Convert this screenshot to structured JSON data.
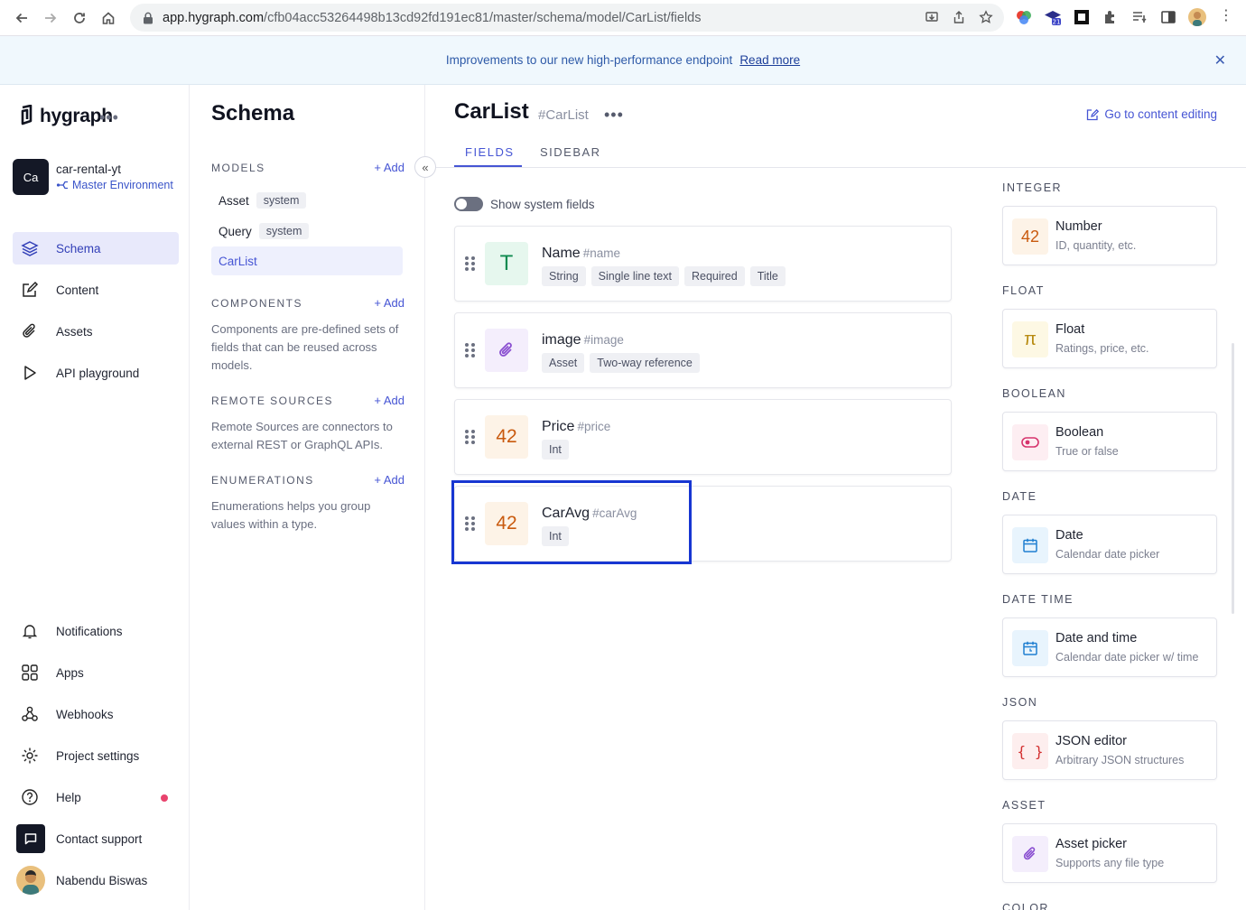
{
  "browser": {
    "url_host": "app.hygraph.com",
    "url_path": "/cfb04acc53264498b13cd92fd191ec81/master/schema/model/CarList/fields",
    "ext_badge": "21"
  },
  "banner": {
    "text": "Improvements to our new high-performance endpoint",
    "link": "Read more"
  },
  "sidebar": {
    "logo": "hygraph",
    "project_initials": "Ca",
    "project_name": "car-rental-yt",
    "environment": "Master Environment",
    "nav": [
      {
        "label": "Schema"
      },
      {
        "label": "Content"
      },
      {
        "label": "Assets"
      },
      {
        "label": "API playground"
      }
    ],
    "bottom": [
      {
        "label": "Notifications"
      },
      {
        "label": "Apps"
      },
      {
        "label": "Webhooks"
      },
      {
        "label": "Project settings"
      },
      {
        "label": "Help"
      },
      {
        "label": "Contact support"
      },
      {
        "label": "Nabendu Biswas"
      }
    ]
  },
  "schema": {
    "title": "Schema",
    "add_label": "Add",
    "models_head": "MODELS",
    "models": [
      {
        "name": "Asset",
        "tag": "system"
      },
      {
        "name": "Query",
        "tag": "system"
      },
      {
        "name": "CarList"
      }
    ],
    "components_head": "COMPONENTS",
    "components_desc": "Components are pre-defined sets of fields that can be reused across models.",
    "remote_head": "REMOTE SOURCES",
    "remote_desc": "Remote Sources are connectors to external REST or GraphQL APIs.",
    "enum_head": "ENUMERATIONS",
    "enum_desc": "Enumerations helps you group values within a type."
  },
  "main": {
    "title": "CarList",
    "api_id": "#CarList",
    "goto": "Go to content editing",
    "tabs": [
      "FIELDS",
      "SIDEBAR"
    ],
    "toggle_label": "Show system fields",
    "fields": [
      {
        "icon": "T",
        "name": "Name",
        "api": "#name",
        "tags": [
          "String",
          "Single line text",
          "Required",
          "Title"
        ]
      },
      {
        "icon": "",
        "name": "image",
        "api": "#image",
        "tags": [
          "Asset",
          "Two-way reference"
        ]
      },
      {
        "icon": "42",
        "name": "Price",
        "api": "#price",
        "tags": [
          "Int"
        ]
      },
      {
        "icon": "42",
        "name": "CarAvg",
        "api": "#carAvg",
        "tags": [
          "Int"
        ]
      }
    ]
  },
  "types": [
    {
      "head": "INTEGER",
      "icon": "42",
      "name": "Number",
      "desc": "ID, quantity, etc."
    },
    {
      "head": "FLOAT",
      "icon": "π",
      "name": "Float",
      "desc": "Ratings, price, etc."
    },
    {
      "head": "BOOLEAN",
      "icon": "",
      "name": "Boolean",
      "desc": "True or false"
    },
    {
      "head": "DATE",
      "icon": "",
      "name": "Date",
      "desc": "Calendar date picker"
    },
    {
      "head": "DATE TIME",
      "icon": "",
      "name": "Date and time",
      "desc": "Calendar date picker w/ time"
    },
    {
      "head": "JSON",
      "icon": "{ }",
      "name": "JSON editor",
      "desc": "Arbitrary JSON structures"
    },
    {
      "head": "ASSET",
      "icon": "",
      "name": "Asset picker",
      "desc": "Supports any file type"
    },
    {
      "head": "COLOR"
    }
  ]
}
